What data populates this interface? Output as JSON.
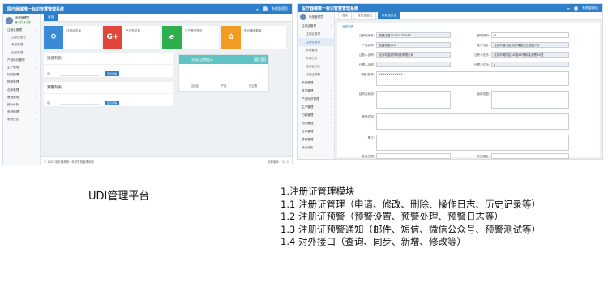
{
  "colors": {
    "header_blue": "#2d7fc9",
    "sidebar_bg": "#f7f8fa",
    "panel_teal": "#5ec3c3",
    "tile_blue": "#3b8ad8",
    "tile_red": "#e0463a",
    "tile_green": "#2eae4c",
    "tile_orange": "#f39c23"
  },
  "left_app": {
    "title": "医疗器械唯一标识智慧管理系统",
    "header_user": "系统管理员",
    "user_name": "系统管理员",
    "user_status": "● 在线  ● 注销",
    "tab": "首页",
    "sidebar": [
      "注册证管理",
      "注册证登记",
      "有效管理",
      "无效管理",
      "产品标识管理",
      "生产管理",
      "扫码管理",
      "物流管理",
      "仓库管理",
      "基础管理",
      "统计分析",
      "系统管理",
      "系统日志"
    ],
    "tiles": [
      {
        "icon": "gear-icon",
        "glyph": "⚙",
        "label": "注册证总量"
      },
      {
        "icon": "google-plus-icon",
        "glyph": "G+",
        "label": "已产品总量"
      },
      {
        "icon": "ie-icon",
        "glyph": "e",
        "label": "生产登记同步"
      },
      {
        "icon": "users-icon",
        "glyph": "✿",
        "label": "登记通道数量"
      }
    ],
    "panel1_title": "消息列表",
    "panel2_title": "预警列表",
    "badge": "显示详情",
    "reminder_title": "注册证过期提示",
    "reminder_cols": [
      "注册证",
      "产品",
      "已过期"
    ],
    "footer_left": "© 2020 医疗器械唯一标识智慧管理系统",
    "footer_right": "当前版本： V1.1"
  },
  "right_app": {
    "title": "医疗器械唯一标识智慧管理系统",
    "header_user": "系统管理员",
    "tabs": [
      "首页",
      "注册证登记",
      "新增注册证"
    ],
    "active_tab": "新增注册证",
    "back_link": "返回列表",
    "sidebar": [
      "注册证管理",
      "注册证管理",
      "注册证管理",
      "申请管理",
      "申请日志",
      "注册证日志",
      "注册证预警",
      "系统管理",
      "财务管理",
      "产品标识管理",
      "生产管理",
      "扫码管理",
      "物流管理",
      "仓库管理",
      "基础管理",
      "统计分析"
    ],
    "fields": {
      "reg_no_label": "注册证编号:",
      "reg_no": "国械注准20162170546",
      "cat_label": "管理类别:",
      "cat": "III",
      "prod_label": "产品名称:",
      "prod": "血糖电极4LC",
      "addr_label": "生产地址:",
      "addr": "北京市通州区张家湾镇工业园区X号",
      "org_label": "注册人名称:",
      "org": "北京市金康华科技有限公司",
      "org_addr_label": "注册人住所:",
      "org_addr": "北京市朝阳区XX路XX号科技大厦XX室",
      "agent_label": "代理人名称:",
      "agent": "/",
      "agent_addr_label": "代理人住所:",
      "agent_addr": "/",
      "spec_label": "规格/型号:",
      "spec": "XXXXXXXXXXXX",
      "struct_label": "结构及组成:",
      "scope_label": "适用范围:",
      "other_label": "其他内容:",
      "remark_label": "备注:",
      "approve_label": "批准日期:",
      "expire_label": "有效期至:"
    }
  },
  "captions": {
    "left": "UDI管理平台",
    "lines": [
      "1.注册证管理模块",
      "1.1 注册证管理（申请、修改、删除、操作日志、历史记录等）",
      "1.2 注册证预警（预警设置、预警处理、预警日志等）",
      "1.3 注册证预警通知（邮件、短信、微信公众号、预警测试等）",
      "1.4 对外接口（查询、同步、新增、修改等）"
    ]
  }
}
